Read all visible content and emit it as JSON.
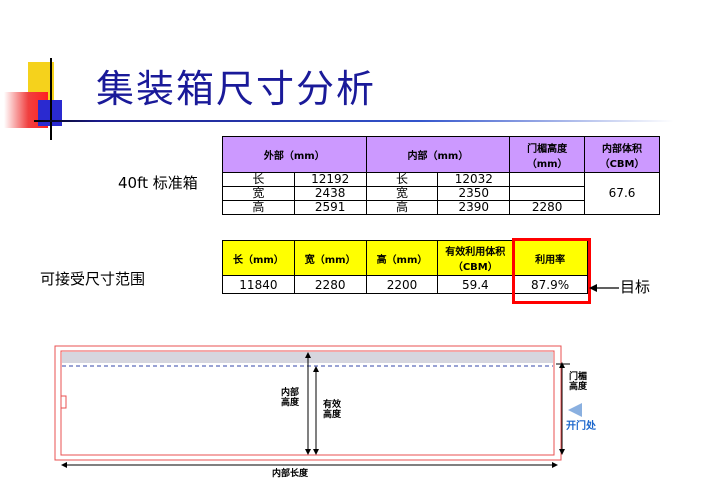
{
  "title": "集装箱尺寸分析",
  "labels": {
    "container_40ft": "40ft 标准箱",
    "acceptable_range": "可接受尺寸范围",
    "target": "目标"
  },
  "table_40ft": {
    "headers": {
      "outer": "外部（mm）",
      "inner": "内部（mm）",
      "door_height": "门楣高度（mm）",
      "inner_volume": "内部体积（CBM）"
    },
    "rows": [
      {
        "outer_dim": "长",
        "outer_val": "12192",
        "inner_dim": "长",
        "inner_val": "12032",
        "door_height": ""
      },
      {
        "outer_dim": "宽",
        "outer_val": "2438",
        "inner_dim": "宽",
        "inner_val": "2350",
        "door_height": ""
      },
      {
        "outer_dim": "高",
        "outer_val": "2591",
        "inner_dim": "高",
        "inner_val": "2390",
        "door_height": "2280"
      }
    ],
    "inner_volume": "67.6"
  },
  "table_range": {
    "headers": {
      "length": "长（mm）",
      "width": "宽（mm）",
      "height": "高（mm）",
      "effective_volume": "有效利用体积（CBM）",
      "utilization": "利用率"
    },
    "values": {
      "length": "11840",
      "width": "2280",
      "height": "2200",
      "effective_volume": "59.4",
      "utilization": "87.9%"
    }
  },
  "diagram": {
    "inner_height": "内部高度",
    "effective_height": "有效高度",
    "door_lintel_height": "门楣高度",
    "door_side": "开门处",
    "inner_length": "内部长度"
  },
  "colors": {
    "title": "#1a1a99",
    "header_purple": "#cc99ff",
    "header_yellow": "#ffff00",
    "highlight_red": "#ff0000",
    "diagram_red": "#e85050",
    "door_blue": "#1a66cc"
  }
}
